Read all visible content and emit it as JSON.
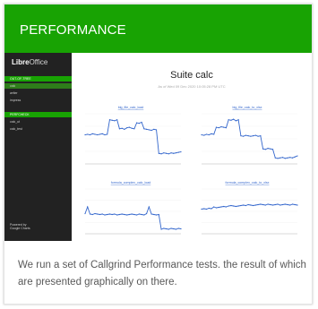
{
  "card": {
    "title": "PERFORMANCE",
    "description": "We run a set of Callgrind Performance tests. the result of which are presented graphically on there.",
    "header_color": "#18a303"
  },
  "screenshot": {
    "sidebar": {
      "logo_bold": "Libre",
      "logo_light": "Office",
      "groups": [
        {
          "label": "OUT-OF-TREE",
          "items": [
            "calc",
            "writer",
            "impress"
          ]
        },
        {
          "label": "PERFCHECK",
          "items": [
            "calc_ut",
            "calc_test"
          ]
        }
      ],
      "active_item": "calc",
      "footer": "Powered by\nGoogle Charts"
    },
    "suite_title": "Suite calc",
    "suite_subtitle": "As of Wed 09 Dec 2020 10:05:28 PM UTC",
    "accent_color": "#18a303"
  },
  "chart_data": [
    {
      "type": "line",
      "title": "big_file_calc_load",
      "x": [
        0,
        1,
        2,
        3,
        4,
        5,
        6,
        7,
        8,
        9,
        10,
        11,
        12,
        13,
        14,
        15,
        16,
        17,
        18,
        19,
        20,
        21,
        22,
        23,
        24,
        25,
        26,
        27,
        28,
        29,
        30,
        31,
        32,
        33,
        34,
        35,
        36,
        37,
        38,
        39
      ],
      "values": [
        58,
        59,
        58,
        60,
        59,
        58,
        59,
        60,
        58,
        59,
        88,
        87,
        86,
        88,
        70,
        71,
        69,
        72,
        73,
        71,
        70,
        82,
        81,
        83,
        70,
        69,
        68,
        67,
        69,
        68,
        21,
        20,
        22,
        21,
        20,
        22,
        21,
        22,
        23,
        24
      ],
      "series_color": "#3366cc"
    },
    {
      "type": "line",
      "title": "big_file_calc_to_xlsx",
      "x": [
        0,
        1,
        2,
        3,
        4,
        5,
        6,
        7,
        8,
        9,
        10,
        11,
        12,
        13,
        14,
        15,
        16,
        17,
        18,
        19,
        20,
        21,
        22,
        23,
        24,
        25,
        26,
        27,
        28,
        29,
        30,
        31,
        32,
        33,
        34,
        35,
        36,
        37,
        38,
        39
      ],
      "values": [
        58,
        57,
        59,
        58,
        60,
        59,
        73,
        72,
        74,
        73,
        72,
        88,
        87,
        89,
        86,
        88,
        56,
        55,
        57,
        56,
        55,
        56,
        57,
        55,
        56,
        30,
        29,
        31,
        30,
        29,
        12,
        11,
        12,
        13,
        11,
        12,
        13,
        12,
        14,
        16
      ],
      "series_color": "#3366cc"
    },
    {
      "type": "line",
      "title": "formula_complex_calc_load",
      "x": [
        0,
        1,
        2,
        3,
        4,
        5,
        6,
        7,
        8,
        9,
        10,
        11,
        12,
        13,
        14,
        15,
        16,
        17,
        18,
        19,
        20,
        21,
        22,
        23,
        24,
        25,
        26,
        27,
        28,
        29,
        30,
        31,
        32,
        33,
        34,
        35,
        36,
        37,
        38,
        39
      ],
      "values": [
        45,
        60,
        44,
        43,
        45,
        44,
        43,
        44,
        42,
        43,
        44,
        43,
        44,
        42,
        43,
        44,
        43,
        42,
        43,
        44,
        43,
        42,
        44,
        43,
        42,
        45,
        60,
        44,
        43,
        42,
        43,
        10,
        12,
        11,
        10,
        12,
        11,
        10,
        12,
        11
      ],
      "series_color": "#3366cc"
    },
    {
      "type": "line",
      "title": "formula_complex_calc_to_xlsx",
      "x": [
        0,
        1,
        2,
        3,
        4,
        5,
        6,
        7,
        8,
        9,
        10,
        11,
        12,
        13,
        14,
        15,
        16,
        17,
        18,
        19,
        20,
        21,
        22,
        23,
        24,
        25,
        26,
        27,
        28,
        29,
        30,
        31,
        32,
        33,
        34,
        35,
        36,
        37,
        38,
        39
      ],
      "values": [
        55,
        56,
        55,
        57,
        56,
        60,
        58,
        59,
        60,
        61,
        60,
        62,
        63,
        62,
        61,
        62,
        63,
        64,
        63,
        65,
        64,
        63,
        64,
        65,
        66,
        65,
        64,
        66,
        65,
        64,
        65,
        66,
        64,
        65,
        66,
        65,
        64,
        66,
        65,
        64
      ],
      "series_color": "#3366cc"
    }
  ]
}
